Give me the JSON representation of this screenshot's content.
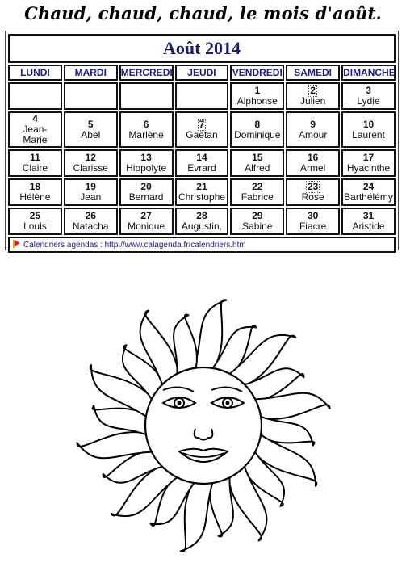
{
  "page": {
    "title": "Chaud, chaud, chaud, le mois d'août."
  },
  "calendar": {
    "month_title": "Août 2014",
    "weekdays": [
      "LUNDI",
      "MARDI",
      "MERCREDI",
      "JEUDI",
      "VENDREDI",
      "SAMEDI",
      "DIMANCHE"
    ],
    "weeks": [
      [
        {
          "num": "",
          "name": ""
        },
        {
          "num": "",
          "name": ""
        },
        {
          "num": "",
          "name": ""
        },
        {
          "num": "",
          "name": ""
        },
        {
          "num": "1",
          "name": "Alphonse"
        },
        {
          "num": "2",
          "name": "Julien",
          "marked": true
        },
        {
          "num": "3",
          "name": "Lydie"
        }
      ],
      [
        {
          "num": "4",
          "name": "Jean-Marie"
        },
        {
          "num": "5",
          "name": "Abel"
        },
        {
          "num": "6",
          "name": "Marlène"
        },
        {
          "num": "7",
          "name": "Gaëtan",
          "marked": true
        },
        {
          "num": "8",
          "name": "Dominique"
        },
        {
          "num": "9",
          "name": "Amour"
        },
        {
          "num": "10",
          "name": "Laurent"
        }
      ],
      [
        {
          "num": "11",
          "name": "Claire"
        },
        {
          "num": "12",
          "name": "Clarisse"
        },
        {
          "num": "13",
          "name": "Hippolyte"
        },
        {
          "num": "14",
          "name": "Evrard"
        },
        {
          "num": "15",
          "name": "Alfred"
        },
        {
          "num": "16",
          "name": "Armel"
        },
        {
          "num": "17",
          "name": "Hyacinthe"
        }
      ],
      [
        {
          "num": "18",
          "name": "Hélène"
        },
        {
          "num": "19",
          "name": "Jean"
        },
        {
          "num": "20",
          "name": "Bernard"
        },
        {
          "num": "21",
          "name": "Christophe"
        },
        {
          "num": "22",
          "name": "Fabrice"
        },
        {
          "num": "23",
          "name": "Rose",
          "marked": true
        },
        {
          "num": "24",
          "name": "Barthélémy"
        }
      ],
      [
        {
          "num": "25",
          "name": "Louis"
        },
        {
          "num": "26",
          "name": "Natacha"
        },
        {
          "num": "27",
          "name": "Monique"
        },
        {
          "num": "28",
          "name": "Augustin."
        },
        {
          "num": "29",
          "name": "Sabine"
        },
        {
          "num": "30",
          "name": "Fiacre"
        },
        {
          "num": "31",
          "name": "Aristide"
        }
      ]
    ],
    "footer": {
      "icon": "flag-icon",
      "text": "Calendriers agendas : http://www.calagenda.fr/calendriers.htm"
    }
  },
  "illustration": {
    "subject": "sun-face-coloring-drawing"
  },
  "colors": {
    "month_title": "#1b1b6b",
    "weekday_text": "#1b1b8b",
    "marked_outline": "#c03030"
  }
}
